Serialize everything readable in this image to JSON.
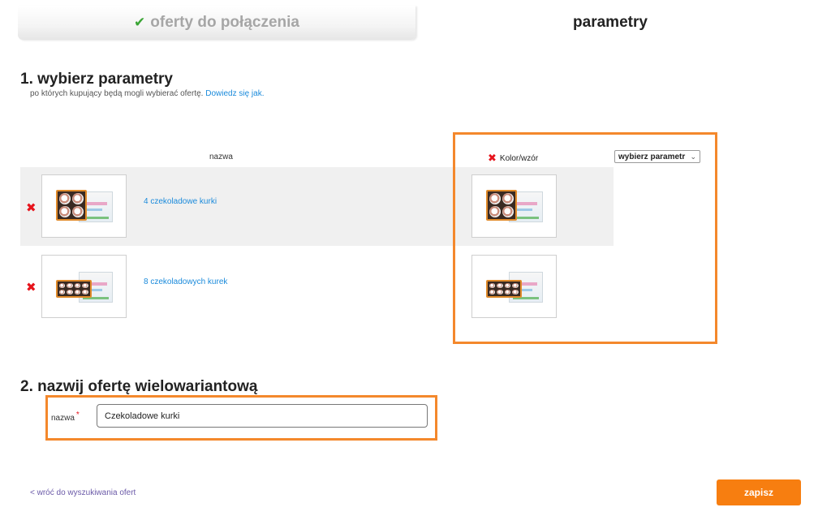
{
  "tabs": {
    "step1": {
      "label": "oferty do połączenia",
      "check_icon": "checkmark-icon"
    },
    "step2": {
      "label": "parametry"
    }
  },
  "section1": {
    "title": "1. wybierz parametry",
    "subtitle": "po których kupujący będą mogli wybierać ofertę.",
    "help_link": "Dowiedz się jak."
  },
  "table": {
    "column_name_header": "nazwa",
    "rows": [
      {
        "name": "4 czekoladowe kurki",
        "delete_icon": "remove-x-icon"
      },
      {
        "name": "8 czekoladowych kurek",
        "delete_icon": "remove-x-icon"
      }
    ]
  },
  "parameter": {
    "name": "Kolor/wzór",
    "select_value": "wybierz parametr"
  },
  "section2": {
    "title": "2. nazwij ofertę wielowariantową",
    "field_label": "nazwa",
    "required_mark": "*",
    "field_value": "Czekoladowe kurki"
  },
  "footer": {
    "back_link": "< wróć do wyszukiwania ofert",
    "save_label": "zapisz"
  },
  "colors": {
    "accent_orange": "#f77e10",
    "highlight_orange": "#f4882c",
    "link_blue": "#1a8adb",
    "delete_red": "#e6141c",
    "check_green": "#3aa535"
  }
}
